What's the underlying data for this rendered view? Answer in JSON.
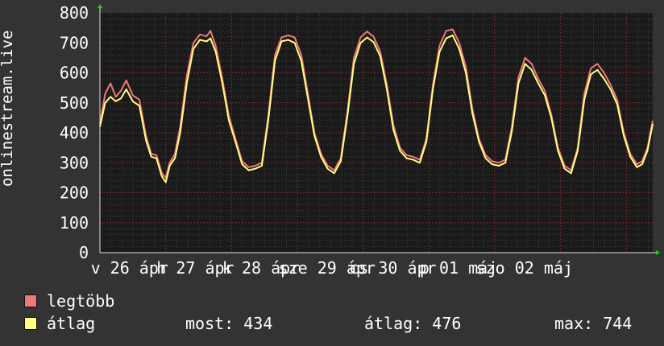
{
  "chart_data": {
    "type": "line",
    "ylabel": "onlinestream.live",
    "ylim": [
      0,
      800
    ],
    "yticks": [
      "800",
      "700",
      "600",
      "500",
      "400",
      "300",
      "200",
      "100",
      "0"
    ],
    "x_labels": [
      "v 26 ápr",
      "h 27 ápr",
      "k 28 ápr",
      "sze 29 ápr",
      "cs 30 ápr",
      "p 01 máj",
      "szo 02 máj"
    ],
    "x_range_days": [
      0,
      6.9
    ],
    "grid": true,
    "series": [
      {
        "name": "legtöbb",
        "color": "#f07878",
        "points": [
          [
            0,
            430
          ],
          [
            0.08,
            530
          ],
          [
            0.16,
            565
          ],
          [
            0.24,
            520
          ],
          [
            0.32,
            540
          ],
          [
            0.4,
            575
          ],
          [
            0.5,
            525
          ],
          [
            0.6,
            510
          ],
          [
            0.7,
            390
          ],
          [
            0.78,
            330
          ],
          [
            0.86,
            325
          ],
          [
            0.94,
            265
          ],
          [
            1.0,
            250
          ],
          [
            1.06,
            300
          ],
          [
            1.14,
            330
          ],
          [
            1.22,
            420
          ],
          [
            1.32,
            590
          ],
          [
            1.42,
            700
          ],
          [
            1.52,
            728
          ],
          [
            1.62,
            722
          ],
          [
            1.68,
            740
          ],
          [
            1.76,
            690
          ],
          [
            1.86,
            580
          ],
          [
            1.96,
            455
          ],
          [
            2.06,
            380
          ],
          [
            2.16,
            305
          ],
          [
            2.26,
            285
          ],
          [
            2.36,
            290
          ],
          [
            2.46,
            300
          ],
          [
            2.56,
            460
          ],
          [
            2.66,
            660
          ],
          [
            2.76,
            718
          ],
          [
            2.86,
            725
          ],
          [
            2.96,
            718
          ],
          [
            3.06,
            660
          ],
          [
            3.16,
            530
          ],
          [
            3.26,
            400
          ],
          [
            3.36,
            330
          ],
          [
            3.46,
            290
          ],
          [
            3.56,
            275
          ],
          [
            3.66,
            315
          ],
          [
            3.76,
            470
          ],
          [
            3.86,
            650
          ],
          [
            3.96,
            718
          ],
          [
            4.06,
            738
          ],
          [
            4.16,
            720
          ],
          [
            4.26,
            670
          ],
          [
            4.36,
            560
          ],
          [
            4.46,
            425
          ],
          [
            4.56,
            350
          ],
          [
            4.66,
            325
          ],
          [
            4.76,
            320
          ],
          [
            4.86,
            310
          ],
          [
            4.96,
            380
          ],
          [
            5.06,
            560
          ],
          [
            5.16,
            690
          ],
          [
            5.26,
            740
          ],
          [
            5.36,
            745
          ],
          [
            5.46,
            700
          ],
          [
            5.56,
            620
          ],
          [
            5.66,
            480
          ],
          [
            5.76,
            380
          ],
          [
            5.86,
            325
          ],
          [
            5.96,
            305
          ],
          [
            6.06,
            300
          ],
          [
            6.16,
            310
          ],
          [
            6.26,
            420
          ],
          [
            6.36,
            585
          ],
          [
            6.46,
            650
          ],
          [
            6.56,
            630
          ],
          [
            6.66,
            580
          ],
          [
            6.76,
            540
          ],
          [
            6.86,
            460
          ],
          [
            6.96,
            350
          ],
          [
            7.06,
            290
          ],
          [
            7.16,
            275
          ],
          [
            7.26,
            350
          ],
          [
            7.36,
            530
          ],
          [
            7.46,
            615
          ],
          [
            7.56,
            630
          ],
          [
            7.66,
            600
          ],
          [
            7.76,
            560
          ],
          [
            7.86,
            510
          ],
          [
            7.96,
            400
          ],
          [
            8.06,
            330
          ],
          [
            8.16,
            295
          ],
          [
            8.24,
            305
          ],
          [
            8.32,
            350
          ],
          [
            8.4,
            440
          ]
        ]
      },
      {
        "name": "átlag",
        "color": "#ffff80",
        "points": [
          [
            0,
            420
          ],
          [
            0.08,
            500
          ],
          [
            0.16,
            520
          ],
          [
            0.24,
            505
          ],
          [
            0.32,
            515
          ],
          [
            0.4,
            545
          ],
          [
            0.5,
            505
          ],
          [
            0.6,
            490
          ],
          [
            0.7,
            375
          ],
          [
            0.78,
            320
          ],
          [
            0.86,
            315
          ],
          [
            0.94,
            255
          ],
          [
            1.0,
            235
          ],
          [
            1.06,
            290
          ],
          [
            1.14,
            315
          ],
          [
            1.22,
            400
          ],
          [
            1.32,
            565
          ],
          [
            1.42,
            680
          ],
          [
            1.52,
            710
          ],
          [
            1.62,
            705
          ],
          [
            1.68,
            715
          ],
          [
            1.76,
            670
          ],
          [
            1.86,
            565
          ],
          [
            1.96,
            440
          ],
          [
            2.06,
            370
          ],
          [
            2.16,
            295
          ],
          [
            2.26,
            275
          ],
          [
            2.36,
            280
          ],
          [
            2.46,
            290
          ],
          [
            2.56,
            445
          ],
          [
            2.66,
            640
          ],
          [
            2.76,
            705
          ],
          [
            2.86,
            710
          ],
          [
            2.96,
            700
          ],
          [
            3.06,
            640
          ],
          [
            3.16,
            515
          ],
          [
            3.26,
            390
          ],
          [
            3.36,
            320
          ],
          [
            3.46,
            280
          ],
          [
            3.56,
            265
          ],
          [
            3.66,
            305
          ],
          [
            3.76,
            455
          ],
          [
            3.86,
            630
          ],
          [
            3.96,
            700
          ],
          [
            4.06,
            718
          ],
          [
            4.16,
            702
          ],
          [
            4.26,
            655
          ],
          [
            4.36,
            545
          ],
          [
            4.46,
            410
          ],
          [
            4.56,
            340
          ],
          [
            4.66,
            315
          ],
          [
            4.76,
            310
          ],
          [
            4.86,
            300
          ],
          [
            4.96,
            370
          ],
          [
            5.06,
            545
          ],
          [
            5.16,
            670
          ],
          [
            5.26,
            715
          ],
          [
            5.36,
            725
          ],
          [
            5.46,
            680
          ],
          [
            5.56,
            600
          ],
          [
            5.66,
            465
          ],
          [
            5.76,
            370
          ],
          [
            5.86,
            315
          ],
          [
            5.96,
            295
          ],
          [
            6.06,
            290
          ],
          [
            6.16,
            300
          ],
          [
            6.26,
            405
          ],
          [
            6.36,
            565
          ],
          [
            6.46,
            630
          ],
          [
            6.56,
            610
          ],
          [
            6.66,
            565
          ],
          [
            6.76,
            525
          ],
          [
            6.86,
            450
          ],
          [
            6.96,
            340
          ],
          [
            7.06,
            280
          ],
          [
            7.16,
            265
          ],
          [
            7.26,
            340
          ],
          [
            7.36,
            510
          ],
          [
            7.46,
            595
          ],
          [
            7.56,
            610
          ],
          [
            7.66,
            580
          ],
          [
            7.76,
            545
          ],
          [
            7.86,
            495
          ],
          [
            7.96,
            390
          ],
          [
            8.06,
            320
          ],
          [
            8.16,
            285
          ],
          [
            8.24,
            295
          ],
          [
            8.32,
            340
          ],
          [
            8.4,
            430
          ]
        ]
      }
    ],
    "stats": {
      "now_label": "most:",
      "now_value": "434",
      "avg_label": "átlag:",
      "avg_value": "476",
      "max_label": "max:",
      "max_value": "744"
    }
  }
}
